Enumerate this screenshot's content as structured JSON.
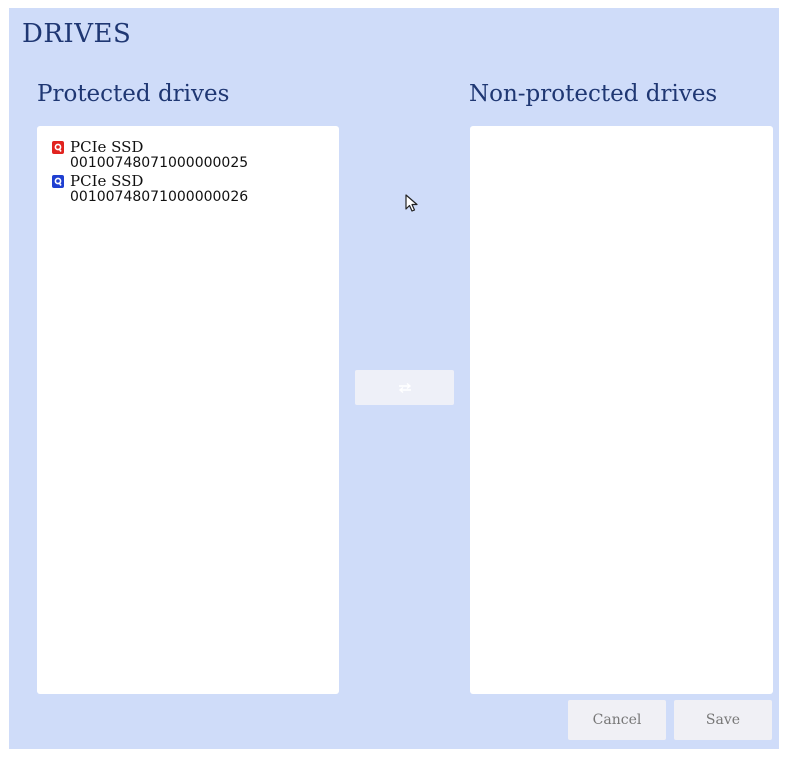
{
  "page": {
    "title": "DRIVES"
  },
  "protected": {
    "title": "Protected drives",
    "drives": [
      {
        "name": "PCIe SSD",
        "serial": "0010074807100000002​5",
        "icon": "drive-icon-red",
        "color": "#e1231f"
      },
      {
        "name": "PCIe SSD",
        "serial": "00100748071000000026",
        "icon": "drive-icon-blue",
        "color": "#1f3fd1"
      }
    ]
  },
  "non_protected": {
    "title": "Non-protected drives",
    "drives": []
  },
  "transfer": {
    "icon": "swap-arrows-icon",
    "enabled": false
  },
  "footer": {
    "cancel_label": "Cancel",
    "save_label": "Save"
  },
  "colors": {
    "panel_bg": "#cfdcf9",
    "title": "#1f3773"
  }
}
